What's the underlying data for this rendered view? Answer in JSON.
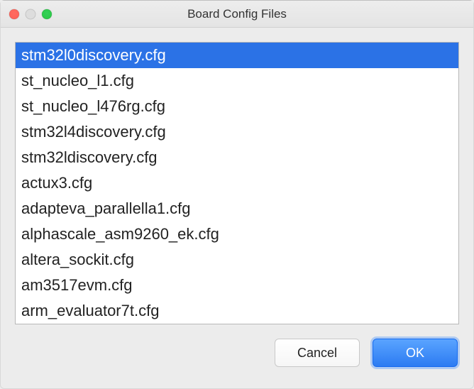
{
  "window": {
    "title": "Board Config Files"
  },
  "list": {
    "selected_index": 0,
    "items": [
      "stm32l0discovery.cfg",
      "st_nucleo_l1.cfg",
      "st_nucleo_l476rg.cfg",
      "stm32l4discovery.cfg",
      "stm32ldiscovery.cfg",
      "actux3.cfg",
      "adapteva_parallella1.cfg",
      "alphascale_asm9260_ek.cfg",
      "altera_sockit.cfg",
      "am3517evm.cfg",
      "arm_evaluator7t.cfg"
    ]
  },
  "buttons": {
    "cancel": "Cancel",
    "ok": "OK"
  }
}
